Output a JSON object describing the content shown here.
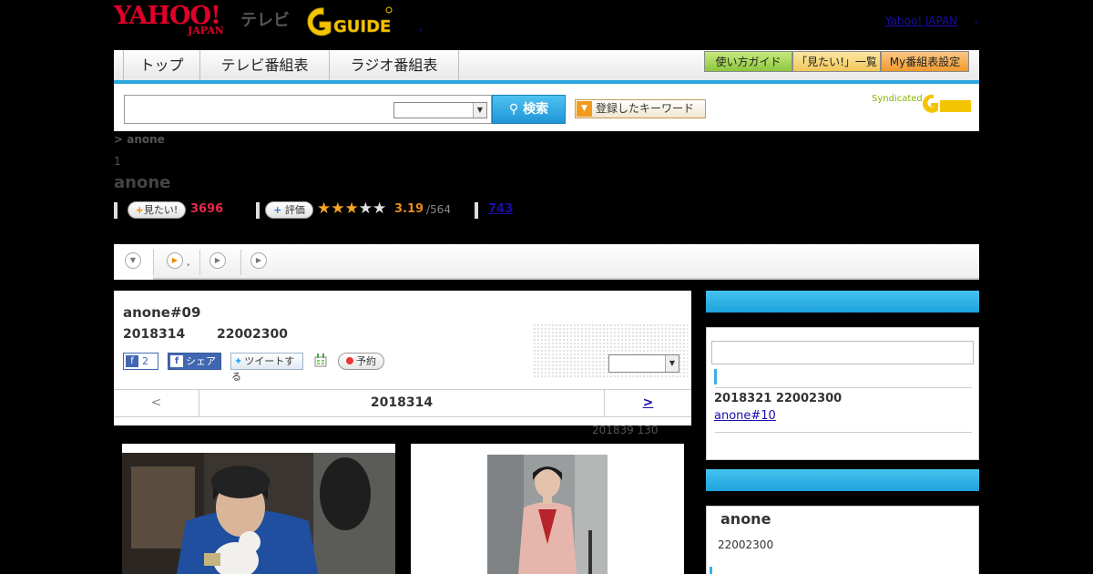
{
  "header": {
    "yahoo_logo": "YAHOO!",
    "yahoo_logo_sub": "JAPAN",
    "tv_label": "テレビ",
    "gguide_logo": "GUIDE",
    "dot": ",",
    "yahoo_japan_link": "Yahoo! JAPAN",
    "yahoo_japan_dot": ","
  },
  "nav": {
    "tabs": [
      {
        "label": "トップ"
      },
      {
        "label": "テレビ番組表"
      },
      {
        "label": "ラジオ番組表"
      }
    ],
    "guide_buttons": [
      {
        "label": "使い方ガイド",
        "color": "#a8d94b"
      },
      {
        "label": "「見たい!」一覧",
        "color": "#f3d57a"
      },
      {
        "label": "My番組表設定",
        "color": "#f3a64a"
      }
    ]
  },
  "search": {
    "input_value": "",
    "select_value": "",
    "button_label": "検索",
    "keyword_button_label": "登録したキーワード",
    "syndicated": "Syndicated"
  },
  "program": {
    "breadcrumb": "> anone",
    "count": "1",
    "title": "anone",
    "want_button": "見たい!",
    "want_count": "3696",
    "rate_button": "評価",
    "stars": "★★★",
    "stars_empty": "★★",
    "score": "3.19",
    "score_count": "/564",
    "link_count": "743"
  },
  "tabs": {
    "tab2_label": ","
  },
  "episode": {
    "title": "anone#09",
    "date": "2018314",
    "time": "22002300",
    "fb_like_count": "2",
    "fb_share": "シェア",
    "tweet": "ツイートする",
    "reserve": "予約",
    "select_value": "",
    "prev": "<",
    "nav_date": "2018314",
    "next": ">",
    "note": "201839  130"
  },
  "sidebar": {
    "next_date": "2018321  22002300",
    "next_link": "anone#10",
    "program_title": "anone",
    "program_time": "22002300"
  },
  "colors": {
    "accent_blue": "#2aa7de",
    "want_pink": "#e6284b",
    "score_orange": "#e88a1a",
    "link": "#1a0dab"
  }
}
